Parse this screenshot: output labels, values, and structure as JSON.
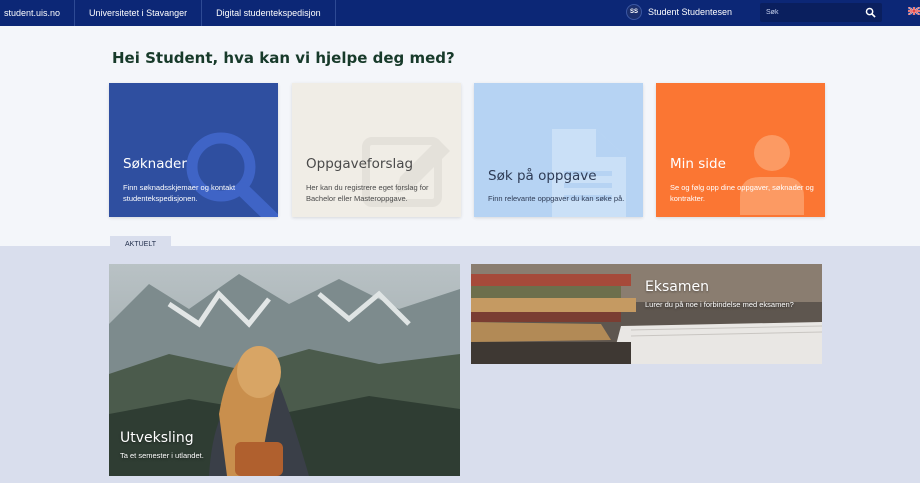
{
  "nav": {
    "links": [
      "student.uis.no",
      "Universitetet i Stavanger",
      "Digital studentekspedisjon"
    ],
    "user_initials": "SS",
    "user_name": "Student Studentesen",
    "search_placeholder": "Søk",
    "language_flag": "uk-flag-icon"
  },
  "greeting": "Hei Student, hva kan vi hjelpe deg med?",
  "tiles": [
    {
      "title": "Søknader",
      "desc": "Finn søknadsskjemaer og kontakt studentekspedisjonen.",
      "icon": "search-icon",
      "color": "#2f4fa0"
    },
    {
      "title": "Oppgaveforslag",
      "desc": "Her kan du registrere eget forslag for Bachelor eller Masteroppgave.",
      "icon": "pencil-icon",
      "color": "#f0ede6"
    },
    {
      "title": "Søk på oppgave",
      "desc": "Finn relevante oppgaver du kan søke på.",
      "icon": "document-icon",
      "color": "#b6d3f3"
    },
    {
      "title": "Min side",
      "desc": "Se og følg opp dine oppgaver, søknader og kontrakter.",
      "icon": "user-icon",
      "color": "#fb7633"
    }
  ],
  "news": {
    "tab_label": "AKTUELT",
    "cards": [
      {
        "title": "Utveksling",
        "desc": "Ta et semester i utlandet."
      },
      {
        "title": "Eksamen",
        "desc": "Lurer du på noe i forbindelse med eksamen?"
      }
    ]
  }
}
